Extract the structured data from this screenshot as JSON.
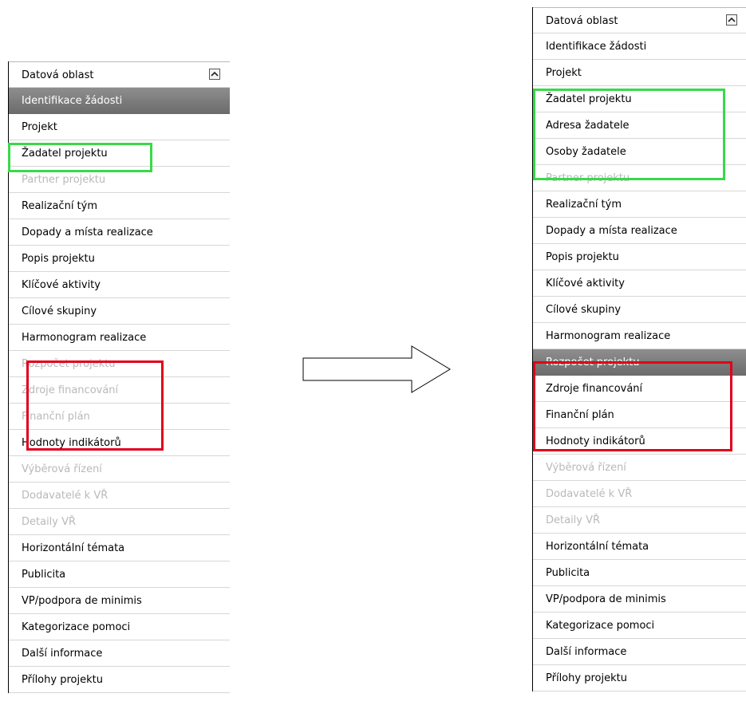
{
  "left": {
    "header": "Datová oblast",
    "items": [
      {
        "label": "Identifikace žádosti",
        "state": "selected"
      },
      {
        "label": "Projekt",
        "state": "normal"
      },
      {
        "label": "Žadatel projektu",
        "state": "normal"
      },
      {
        "label": "Partner projektu",
        "state": "disabled"
      },
      {
        "label": "Realizační tým",
        "state": "normal"
      },
      {
        "label": "Dopady a místa realizace",
        "state": "normal"
      },
      {
        "label": "Popis projektu",
        "state": "normal"
      },
      {
        "label": "Klíčové aktivity",
        "state": "normal"
      },
      {
        "label": "Cílové skupiny",
        "state": "normal"
      },
      {
        "label": "Harmonogram realizace",
        "state": "normal"
      },
      {
        "label": "Rozpočet projektu",
        "state": "disabled"
      },
      {
        "label": "Zdroje financování",
        "state": "disabled"
      },
      {
        "label": "Finanční plán",
        "state": "disabled"
      },
      {
        "label": "Hodnoty indikátorů",
        "state": "normal"
      },
      {
        "label": "Výběrová řízení",
        "state": "disabled"
      },
      {
        "label": "Dodavatelé k VŘ",
        "state": "disabled"
      },
      {
        "label": "Detaily VŘ",
        "state": "disabled"
      },
      {
        "label": "Horizontální témata",
        "state": "normal"
      },
      {
        "label": "Publicita",
        "state": "normal"
      },
      {
        "label": "VP/podpora de minimis",
        "state": "normal"
      },
      {
        "label": "Kategorizace pomoci",
        "state": "normal"
      },
      {
        "label": "Další informace",
        "state": "normal"
      },
      {
        "label": "Přílohy projektu",
        "state": "normal"
      }
    ]
  },
  "right": {
    "header": "Datová oblast",
    "items": [
      {
        "label": "Identifikace žádosti",
        "state": "normal"
      },
      {
        "label": "Projekt",
        "state": "normal"
      },
      {
        "label": "Žadatel projektu",
        "state": "normal"
      },
      {
        "label": "Adresa žadatele",
        "state": "normal"
      },
      {
        "label": "Osoby žadatele",
        "state": "normal"
      },
      {
        "label": "Partner projektu",
        "state": "disabled"
      },
      {
        "label": "Realizační tým",
        "state": "normal"
      },
      {
        "label": "Dopady a místa realizace",
        "state": "normal"
      },
      {
        "label": "Popis projektu",
        "state": "normal"
      },
      {
        "label": "Klíčové aktivity",
        "state": "normal"
      },
      {
        "label": "Cílové skupiny",
        "state": "normal"
      },
      {
        "label": "Harmonogram realizace",
        "state": "normal"
      },
      {
        "label": "Rozpočet projektu",
        "state": "selected"
      },
      {
        "label": "Zdroje financování",
        "state": "normal"
      },
      {
        "label": "Finanční plán",
        "state": "normal"
      },
      {
        "label": "Hodnoty indikátorů",
        "state": "normal"
      },
      {
        "label": "Výběrová řízení",
        "state": "disabled"
      },
      {
        "label": "Dodavatelé k VŘ",
        "state": "disabled"
      },
      {
        "label": "Detaily VŘ",
        "state": "disabled"
      },
      {
        "label": "Horizontální témata",
        "state": "normal"
      },
      {
        "label": "Publicita",
        "state": "normal"
      },
      {
        "label": "VP/podpora de minimis",
        "state": "normal"
      },
      {
        "label": "Kategorizace pomoci",
        "state": "normal"
      },
      {
        "label": "Další informace",
        "state": "normal"
      },
      {
        "label": "Přílohy projektu",
        "state": "normal"
      }
    ]
  },
  "colors": {
    "highlight_green": "#39d94a",
    "highlight_red": "#e0001b",
    "selected_row": "#7d7d7d",
    "disabled_text": "#b9b9b9"
  },
  "icons": {
    "collapse": "chevron-up-icon",
    "transition": "right-arrow-icon"
  }
}
